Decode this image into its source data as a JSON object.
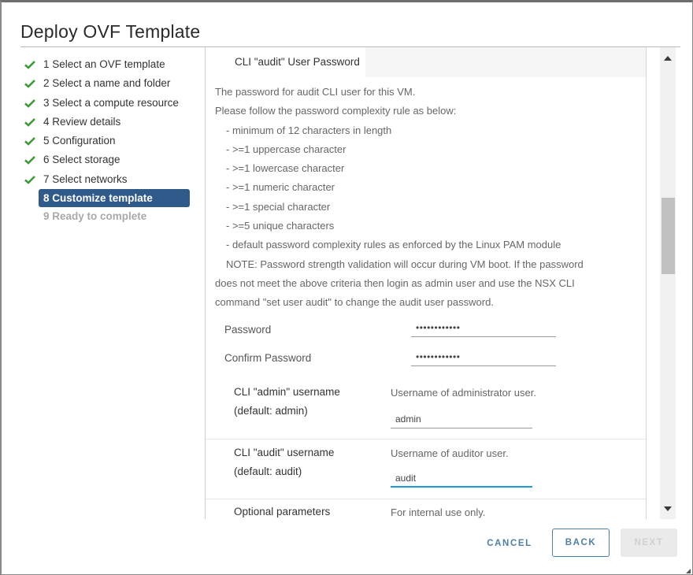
{
  "dialog": {
    "title": "Deploy OVF Template"
  },
  "steps": [
    {
      "label": "1 Select an OVF template",
      "state": "complete"
    },
    {
      "label": "2 Select a name and folder",
      "state": "complete"
    },
    {
      "label": "3 Select a compute resource",
      "state": "complete"
    },
    {
      "label": "4 Review details",
      "state": "complete"
    },
    {
      "label": "5 Configuration",
      "state": "complete"
    },
    {
      "label": "6 Select storage",
      "state": "complete"
    },
    {
      "label": "7 Select networks",
      "state": "complete"
    },
    {
      "label": "8 Customize template",
      "state": "active"
    },
    {
      "label": "9 Ready to complete",
      "state": "disabled"
    }
  ],
  "section": {
    "title": "CLI \"audit\" User Password",
    "description": [
      "The password for audit CLI user for this VM.",
      "Please follow the password complexity rule as below:",
      "- minimum of 12 characters in length",
      "- >=1 uppercase character",
      "- >=1 lowercase character",
      "- >=1 numeric character",
      "- >=1 special character",
      "- >=5 unique characters",
      "- default password complexity rules as enforced by the Linux PAM module",
      "NOTE: Password strength validation will occur during VM boot.  If the password",
      "does not meet the above criteria then login as admin user and use the NSX CLI",
      "command \"set user audit\" to change the audit user password."
    ],
    "password_label": "Password",
    "password_value": "••••••••••••",
    "confirm_label": "Confirm Password",
    "confirm_value": "••••••••••••"
  },
  "properties": [
    {
      "name_line1": "CLI \"admin\" username",
      "name_line2": "(default: admin)",
      "description": "Username of administrator user.",
      "value": "admin"
    },
    {
      "name_line1": "CLI \"audit\" username",
      "name_line2": "(default: audit)",
      "description": "Username of auditor user.",
      "value": "audit"
    },
    {
      "name_line1": "Optional parameters",
      "description": "For internal use only."
    }
  ],
  "footer": {
    "cancel": "CANCEL",
    "back": "BACK",
    "next": "NEXT"
  },
  "colors": {
    "active_step_bg": "#2f5a8a",
    "check_green": "#3c9a36",
    "focus_blue": "#1a9ed4",
    "button_blue": "#4d7ea8"
  }
}
